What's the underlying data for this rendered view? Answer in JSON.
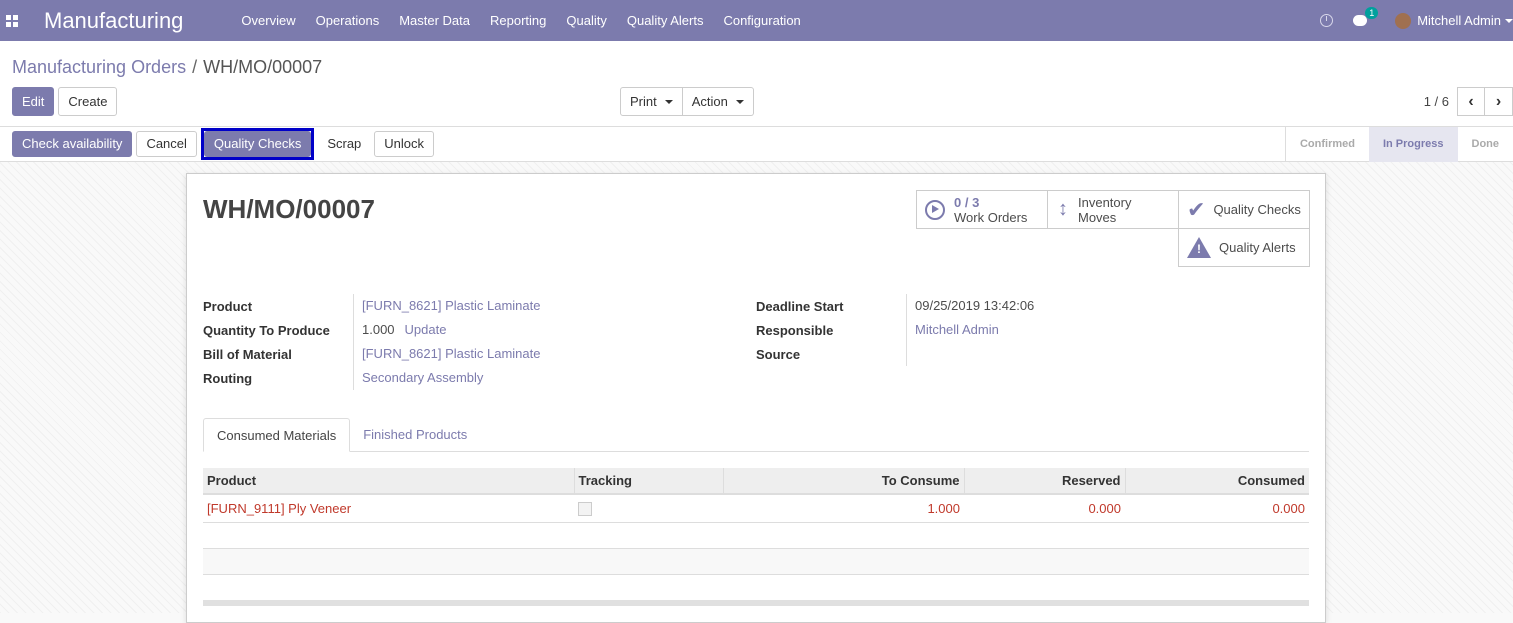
{
  "navbar": {
    "app_title": "Manufacturing",
    "menu": [
      "Overview",
      "Operations",
      "Master Data",
      "Reporting",
      "Quality",
      "Quality Alerts",
      "Configuration"
    ],
    "chat_badge": "1",
    "user_name": "Mitchell Admin",
    "icons": [
      "apps-icon",
      "clock-icon",
      "chat-icon",
      "avatar"
    ]
  },
  "breadcrumb": {
    "parent": "Manufacturing Orders",
    "separator": "/",
    "current": "WH/MO/00007"
  },
  "toolbar": {
    "edit": "Edit",
    "create": "Create",
    "print": "Print",
    "action": "Action",
    "pager": "1 / 6"
  },
  "statusbar": {
    "buttons": {
      "check_availability": "Check availability",
      "cancel": "Cancel",
      "quality_checks": "Quality Checks",
      "scrap": "Scrap",
      "unlock": "Unlock"
    },
    "stages": [
      "Confirmed",
      "In Progress",
      "Done"
    ],
    "active_stage": "In Progress"
  },
  "record": {
    "title": "WH/MO/00007",
    "smart_buttons": {
      "work_orders_count": "0 / 3",
      "work_orders_label": "Work Orders",
      "inventory_line1": "Inventory",
      "inventory_line2": "Moves",
      "quality_checks": "Quality Checks",
      "quality_alerts": "Quality Alerts"
    },
    "left_fields": {
      "product_label": "Product",
      "product_value": "[FURN_8621] Plastic Laminate",
      "qty_label": "Quantity To Produce",
      "qty_value": "1.000",
      "qty_update": "Update",
      "bom_label": "Bill of Material",
      "bom_value": "[FURN_8621] Plastic Laminate",
      "routing_label": "Routing",
      "routing_value": "Secondary Assembly"
    },
    "right_fields": {
      "deadline_label": "Deadline Start",
      "deadline_value": "09/25/2019 13:42:06",
      "responsible_label": "Responsible",
      "responsible_value": "Mitchell Admin",
      "source_label": "Source",
      "source_value": ""
    },
    "tabs": [
      "Consumed Materials",
      "Finished Products"
    ],
    "table": {
      "headers": [
        "Product",
        "Tracking",
        "To Consume",
        "Reserved",
        "Consumed"
      ],
      "rows": [
        {
          "product": "[FURN_9111] Ply Veneer",
          "tracking": "",
          "to_consume": "1.000",
          "reserved": "0.000",
          "consumed": "0.000"
        }
      ]
    }
  },
  "colors": {
    "brand": "#7c7bad",
    "highlight": "#0000c8",
    "row_text": "#c0392b"
  }
}
